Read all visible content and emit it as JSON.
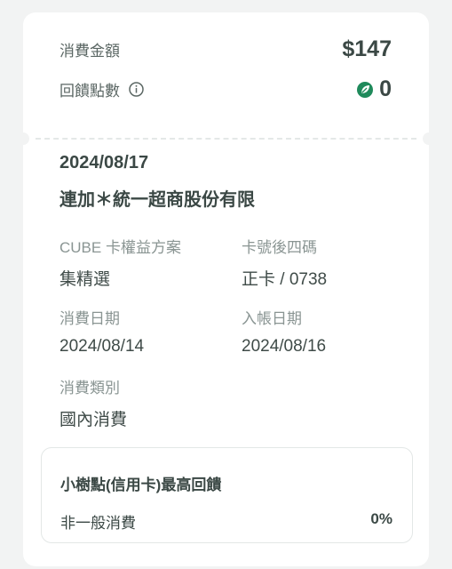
{
  "summary": {
    "amount_label": "消費金額",
    "amount_value": "$147",
    "points_label": "回饋點數",
    "points_value": "0"
  },
  "transaction": {
    "date": "2024/08/17",
    "merchant": "連加＊統一超商股份有限",
    "fields": [
      {
        "label": "CUBE 卡權益方案",
        "value": "集精選"
      },
      {
        "label": "卡號後四碼",
        "value": "正卡 / 0738"
      },
      {
        "label": "消費日期",
        "value": "2024/08/14"
      },
      {
        "label": "入帳日期",
        "value": "2024/08/16"
      },
      {
        "label": "消費類別",
        "value": "國內消費"
      }
    ]
  },
  "reward": {
    "title": "小樹點(信用卡)最高回饋",
    "row_label": "非一般消費",
    "row_value": "0%"
  },
  "icons": {
    "info": "info-circle-icon",
    "points": "leaf-coin-icon"
  },
  "colors": {
    "accent_green": "#1f8a5b",
    "text_dark": "#3b4845",
    "text_muted": "#8a9593"
  }
}
